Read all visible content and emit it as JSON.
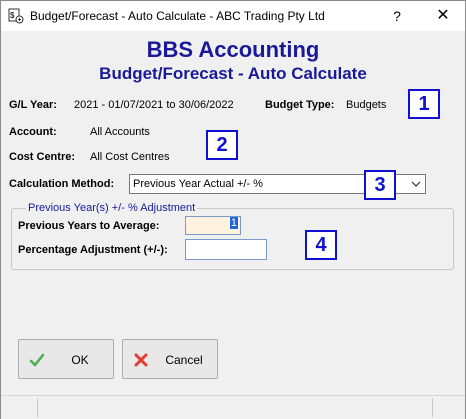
{
  "window": {
    "title": "Budget/Forecast - Auto Calculate - ABC Trading Pty Ltd",
    "help_label": "?",
    "close_label": "✕"
  },
  "header": {
    "app_name": "BBS Accounting",
    "subtitle": "Budget/Forecast - Auto Calculate"
  },
  "info": {
    "gl_year_label": "G/L Year:",
    "gl_year_value": "2021 - 01/07/2021 to 30/06/2022",
    "budget_type_label": "Budget Type:",
    "budget_type_value": "Budgets",
    "account_label": "Account:",
    "account_value": "All Accounts",
    "cost_centre_label": "Cost Centre:",
    "cost_centre_value": "All Cost Centres"
  },
  "calculation": {
    "method_label": "Calculation Method:",
    "method_value": "Previous Year Actual +/- %"
  },
  "group": {
    "legend": "Previous Year(s) +/- % Adjustment",
    "years_label": "Previous Years to Average:",
    "years_value": "1",
    "pct_label": "Percentage Adjustment (+/-):",
    "pct_value": ""
  },
  "callouts": [
    "1",
    "2",
    "3",
    "4"
  ],
  "buttons": {
    "ok_label": "OK",
    "cancel_label": "Cancel"
  },
  "colors": {
    "heading": "#1a1a99",
    "callout": "#1010d0",
    "ok_icon": "#4caf50",
    "cancel_icon": "#e53935"
  },
  "icons": {
    "app": "app-icon",
    "ok": "checkmark-icon",
    "cancel": "cross-icon",
    "dropdown": "chevron-down-icon"
  }
}
